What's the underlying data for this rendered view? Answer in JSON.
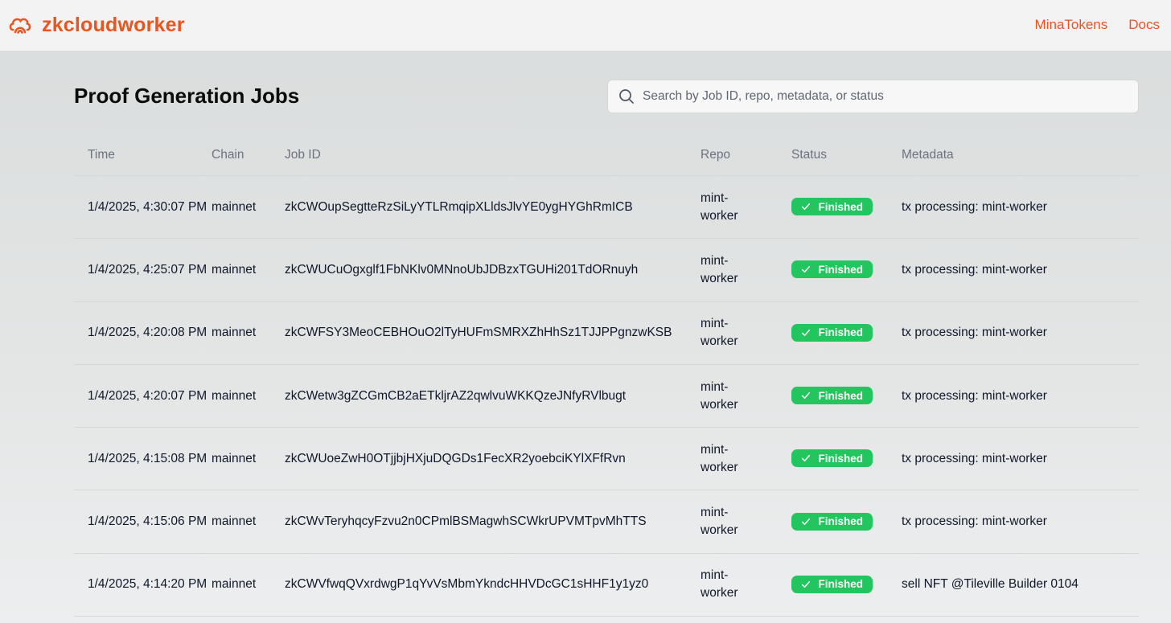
{
  "header": {
    "brand": "zkcloudworker",
    "nav": [
      "MinaTokens",
      "Docs"
    ]
  },
  "page": {
    "title": "Proof Generation Jobs"
  },
  "search": {
    "placeholder": "Search by Job ID, repo, metadata, or status"
  },
  "table": {
    "columns": [
      "Time",
      "Chain",
      "Job ID",
      "Repo",
      "Status",
      "Metadata"
    ],
    "rows": [
      {
        "time": "1/4/2025, 4:30:07 PM",
        "chain": "mainnet",
        "job_id": "zkCWOupSegtteRzSiLyYTLRmqipXLldsJlvYE0ygHYGhRmICB",
        "repo": "mint-worker",
        "status": "Finished",
        "metadata": "tx processing: mint-worker"
      },
      {
        "time": "1/4/2025, 4:25:07 PM",
        "chain": "mainnet",
        "job_id": "zkCWUCuOgxglf1FbNKlv0MNnoUbJDBzxTGUHi201TdORnuyh",
        "repo": "mint-worker",
        "status": "Finished",
        "metadata": "tx processing: mint-worker"
      },
      {
        "time": "1/4/2025, 4:20:08 PM",
        "chain": "mainnet",
        "job_id": "zkCWFSY3MeoCEBHOuO2lTyHUFmSMRXZhHhSz1TJJPPgnzwKSB",
        "repo": "mint-worker",
        "status": "Finished",
        "metadata": "tx processing: mint-worker"
      },
      {
        "time": "1/4/2025, 4:20:07 PM",
        "chain": "mainnet",
        "job_id": "zkCWetw3gZCGmCB2aETkljrAZ2qwlvuWKKQzeJNfyRVlbugt",
        "repo": "mint-worker",
        "status": "Finished",
        "metadata": "tx processing: mint-worker"
      },
      {
        "time": "1/4/2025, 4:15:08 PM",
        "chain": "mainnet",
        "job_id": "zkCWUoeZwH0OTjjbjHXjuDQGDs1FecXR2yoebciKYlXFfRvn",
        "repo": "mint-worker",
        "status": "Finished",
        "metadata": "tx processing: mint-worker"
      },
      {
        "time": "1/4/2025, 4:15:06 PM",
        "chain": "mainnet",
        "job_id": "zkCWvTeryhqcyFzvu2n0CPmlBSMagwhSCWkrUPVMTpvMhTTS",
        "repo": "mint-worker",
        "status": "Finished",
        "metadata": "tx processing: mint-worker"
      },
      {
        "time": "1/4/2025, 4:14:20 PM",
        "chain": "mainnet",
        "job_id": "zkCWVfwqQVxrdwgP1qYvVsMbmYkndcHHVDcGC1sHHF1y1yz0",
        "repo": "mint-worker",
        "status": "Finished",
        "metadata": "sell NFT @Tileville Builder 0104"
      }
    ]
  },
  "colors": {
    "brand": "#e8551e",
    "status_finished": "#22c55e"
  },
  "icons": {
    "logo": "cloud-logo-icon",
    "search": "search-icon",
    "status": "check-icon"
  }
}
